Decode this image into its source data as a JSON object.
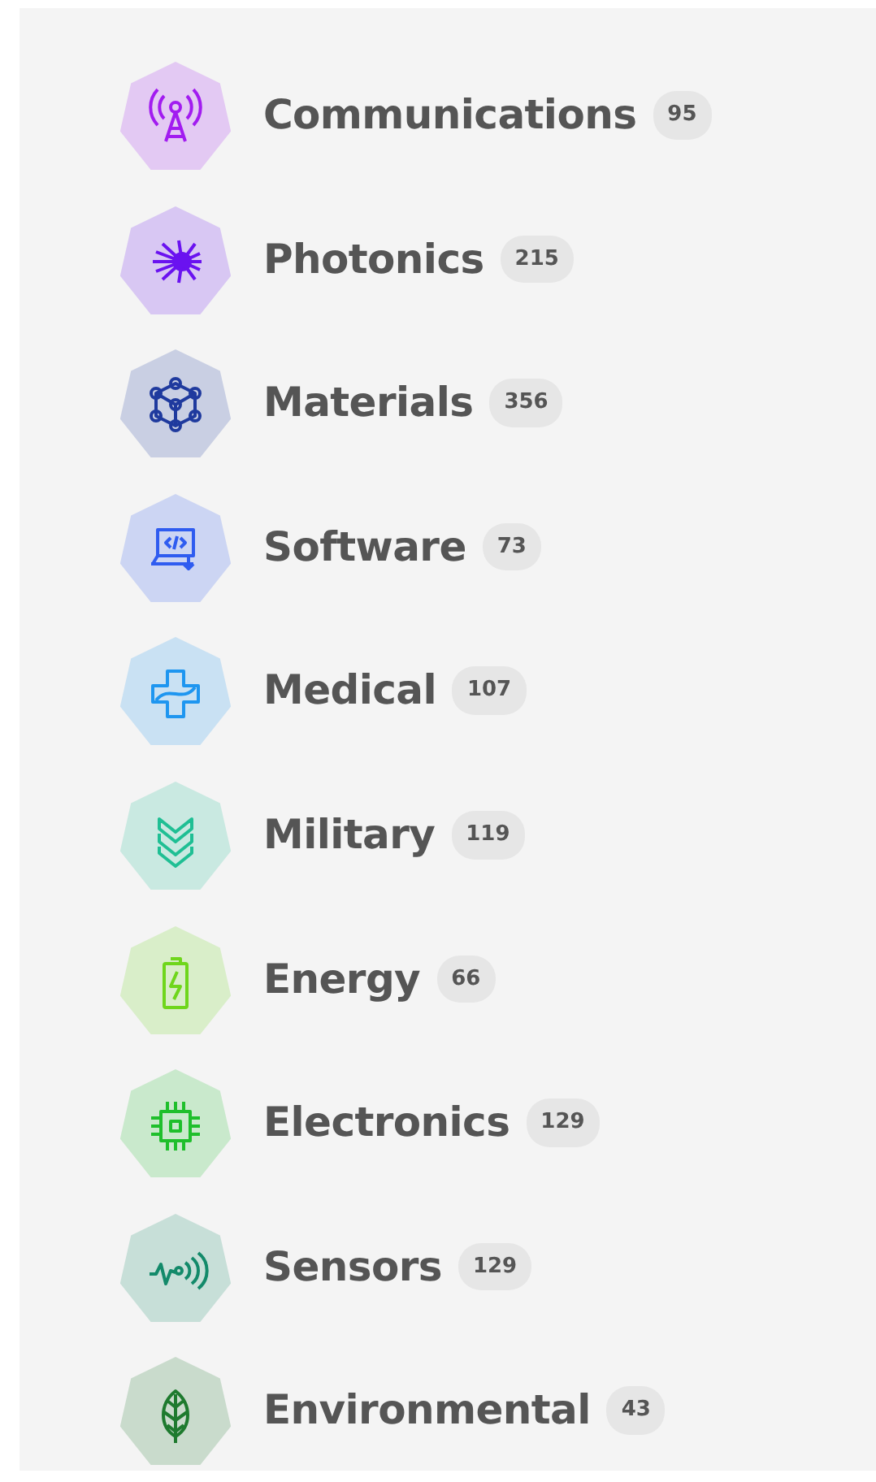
{
  "categories": [
    {
      "label": "Communications",
      "count": "95",
      "color": "#a21cf0"
    },
    {
      "label": "Photonics",
      "count": "215",
      "color": "#6a12f0"
    },
    {
      "label": "Materials",
      "count": "356",
      "color": "#1f3a9e"
    },
    {
      "label": "Software",
      "count": "73",
      "color": "#2f5cf0"
    },
    {
      "label": "Medical",
      "count": "107",
      "color": "#1e96f0"
    },
    {
      "label": "Military",
      "count": "119",
      "color": "#1fbf94"
    },
    {
      "label": "Energy",
      "count": "66",
      "color": "#6fd61c"
    },
    {
      "label": "Electronics",
      "count": "129",
      "color": "#1fbf2c"
    },
    {
      "label": "Sensors",
      "count": "129",
      "color": "#138a6a"
    },
    {
      "label": "Environmental",
      "count": "43",
      "color": "#1e7a2e"
    }
  ]
}
